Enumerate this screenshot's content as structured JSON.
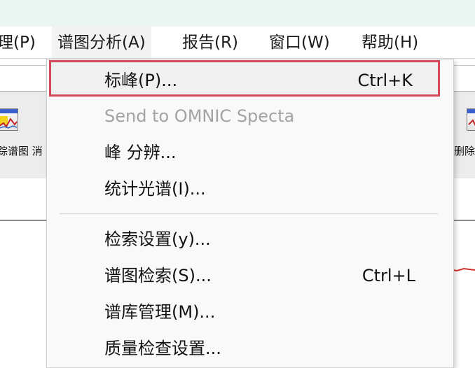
{
  "menubar": {
    "items": [
      {
        "label": "理(P)"
      },
      {
        "label": "谱图分析(A)"
      },
      {
        "label": "报告(R)"
      },
      {
        "label": "窗口(W)"
      },
      {
        "label": "帮助(H)"
      }
    ]
  },
  "toolbar": {
    "left_label": "踪谱图 消",
    "right_label": "删除"
  },
  "dropdown": {
    "items": [
      {
        "label": "标峰(P)...",
        "shortcut": "Ctrl+K",
        "state": "highlighted"
      },
      {
        "label": "Send to OMNIC Specta",
        "shortcut": "",
        "state": "disabled"
      },
      {
        "label": "峰 分辨...",
        "shortcut": "",
        "state": "normal"
      },
      {
        "label": "统计光谱(I)...",
        "shortcut": "",
        "state": "normal"
      },
      {
        "label": "检索设置(y)...",
        "shortcut": "",
        "state": "normal"
      },
      {
        "label": "谱图检索(S)...",
        "shortcut": "Ctrl+L",
        "state": "normal"
      },
      {
        "label": "谱库管理(M)...",
        "shortcut": "",
        "state": "normal"
      },
      {
        "label": "质量检查设置...",
        "shortcut": "",
        "state": "normal"
      }
    ]
  },
  "colors": {
    "highlight_border": "#d54a5a",
    "title_bar": "#e9f6f1",
    "disabled_text": "#a3a3a3",
    "spectrum_line": "#d0302a"
  }
}
